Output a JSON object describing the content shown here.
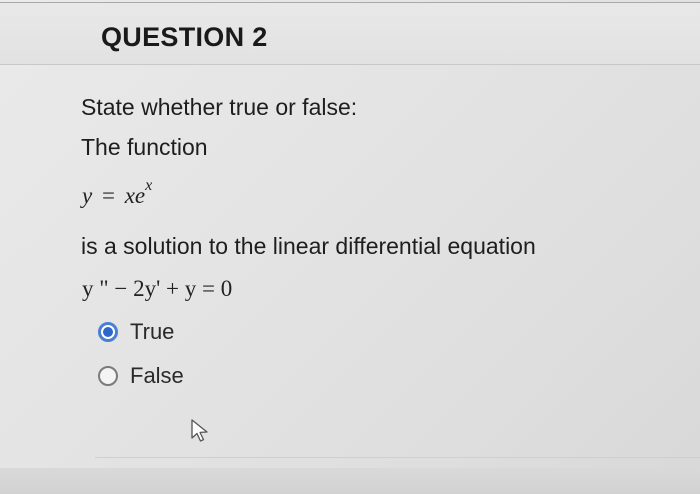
{
  "question": {
    "title": "QUESTION 2",
    "prompt_line_1": "State whether true or false:",
    "prompt_line_2": "The function",
    "equation_1": {
      "lhs": "y",
      "op": "=",
      "rhs_base": "xe",
      "rhs_exp": "x"
    },
    "prompt_line_3": "is a solution to the linear differential equation",
    "equation_2": "y \"  −  2y' + y = 0"
  },
  "options": [
    {
      "label": "True",
      "selected": true
    },
    {
      "label": "False",
      "selected": false
    }
  ],
  "colors": {
    "radio_selected": "#2e66cc",
    "radio_ring": "#4a7fd6",
    "text": "#1e1e1e"
  },
  "icons": {
    "cursor": "mouse-pointer-arrow-icon"
  }
}
